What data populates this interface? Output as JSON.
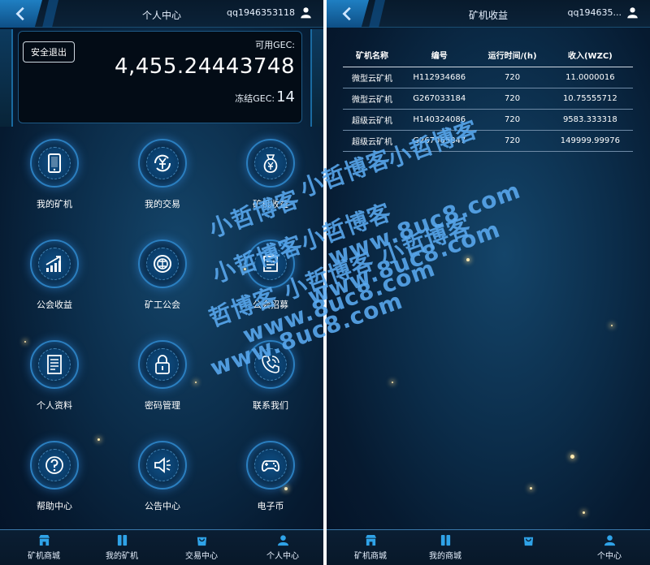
{
  "left": {
    "title": "个人中心",
    "user": "qq1946353118",
    "logout": "安全退出",
    "available_label": "可用GEC:",
    "available_value": "4,455.24443748",
    "frozen_label": "冻结GEC:",
    "frozen_value": "14",
    "tiles": [
      {
        "label": "我的矿机",
        "icon": "tablet-icon"
      },
      {
        "label": "我的交易",
        "icon": "yuan-exchange-icon"
      },
      {
        "label": "矿机收益",
        "icon": "money-bag-icon"
      },
      {
        "label": "公会收益",
        "icon": "chart-up-icon"
      },
      {
        "label": "矿工公会",
        "icon": "guild-coin-icon"
      },
      {
        "label": "公会招募",
        "icon": "recruit-sign-icon"
      },
      {
        "label": "个人资料",
        "icon": "document-icon"
      },
      {
        "label": "密码管理",
        "icon": "lock-icon"
      },
      {
        "label": "联系我们",
        "icon": "phone-icon"
      },
      {
        "label": "帮助中心",
        "icon": "help-icon"
      },
      {
        "label": "公告中心",
        "icon": "speaker-icon"
      },
      {
        "label": "电子币",
        "icon": "gamepad-icon"
      }
    ],
    "tabs": [
      {
        "label": "矿机商城",
        "icon": "shop-icon"
      },
      {
        "label": "我的矿机",
        "icon": "columns-icon"
      },
      {
        "label": "交易中心",
        "icon": "bag-icon"
      },
      {
        "label": "个人中心",
        "icon": "user-icon"
      }
    ]
  },
  "right": {
    "title": "矿机收益",
    "user": "qq194635...",
    "table": {
      "headers": [
        "矿机名称",
        "编号",
        "运行时间/(h)",
        "收入(WZC)"
      ],
      "rows": [
        [
          "微型云矿机",
          "H112934686",
          "720",
          "11.0000016"
        ],
        [
          "微型云矿机",
          "G267033184",
          "720",
          "10.75555712"
        ],
        [
          "超级云矿机",
          "H140324086",
          "720",
          "9583.333318"
        ],
        [
          "超级云矿机",
          "G267065847",
          "720",
          "149999.99976"
        ]
      ]
    },
    "tabs": [
      {
        "label": "矿机商城",
        "icon": "shop-icon"
      },
      {
        "label": "我的商城",
        "icon": "columns-icon"
      },
      {
        "label": "",
        "icon": "bag-icon"
      },
      {
        "label": "个中心",
        "icon": "user-icon"
      }
    ]
  },
  "watermark": [
    "小哲博客",
    "小哲博客",
    "小哲博客",
    "小哲博客小哲博客",
    "哲博客 小哲博客 小哲博客",
    "www.8uc8.com",
    "www.8uc8.com",
    "www.8uc8.com",
    "www.8uc8.com"
  ],
  "colors": {
    "accent": "#2b7fc0",
    "background": "#0b2c49",
    "card": "#030c16"
  }
}
